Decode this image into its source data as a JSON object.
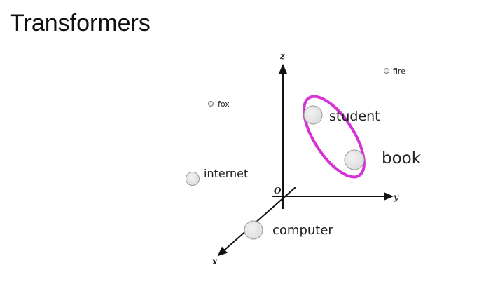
{
  "slide": {
    "title": "Transformers"
  },
  "diagram": {
    "axes": {
      "x": "x",
      "y": "y",
      "z": "z",
      "origin": "O"
    },
    "words": {
      "fire": "fire",
      "fox": "fox",
      "student": "student",
      "book": "book",
      "internet": "internet",
      "computer": "computer"
    },
    "highlight_color": "#d633d6"
  }
}
